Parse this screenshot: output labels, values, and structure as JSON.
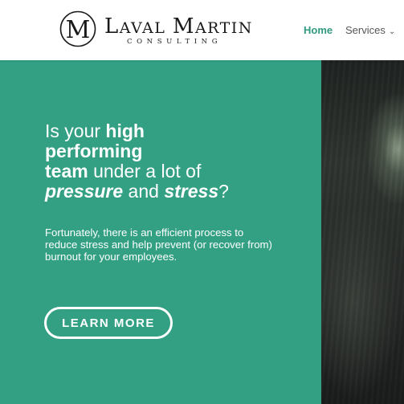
{
  "brand": {
    "name": "Laval Martin",
    "subtitle": "CONSULTING",
    "monogram": "M",
    "ink_color": "#1a1a1a"
  },
  "nav": {
    "items": [
      {
        "label": "Home",
        "active": true
      },
      {
        "label": "Services",
        "has_dropdown": true,
        "icon": "chevron-down-icon"
      }
    ],
    "active_color": "#2f9a80"
  },
  "hero": {
    "background_color": "#33a084",
    "headline": {
      "l1_a": "Is your ",
      "l1_b": "high",
      "l2": "performing",
      "l3_a": "team",
      "l3_b": " under a lot of",
      "l4_a": "pressure",
      "l4_b": " and ",
      "l4_c": "stress",
      "l4_d": "?"
    },
    "body": "Fortunately, there is an efficient process to reduce stress and help prevent (or recover from) burnout for your employees.",
    "cta_label": "LEARN MORE"
  }
}
